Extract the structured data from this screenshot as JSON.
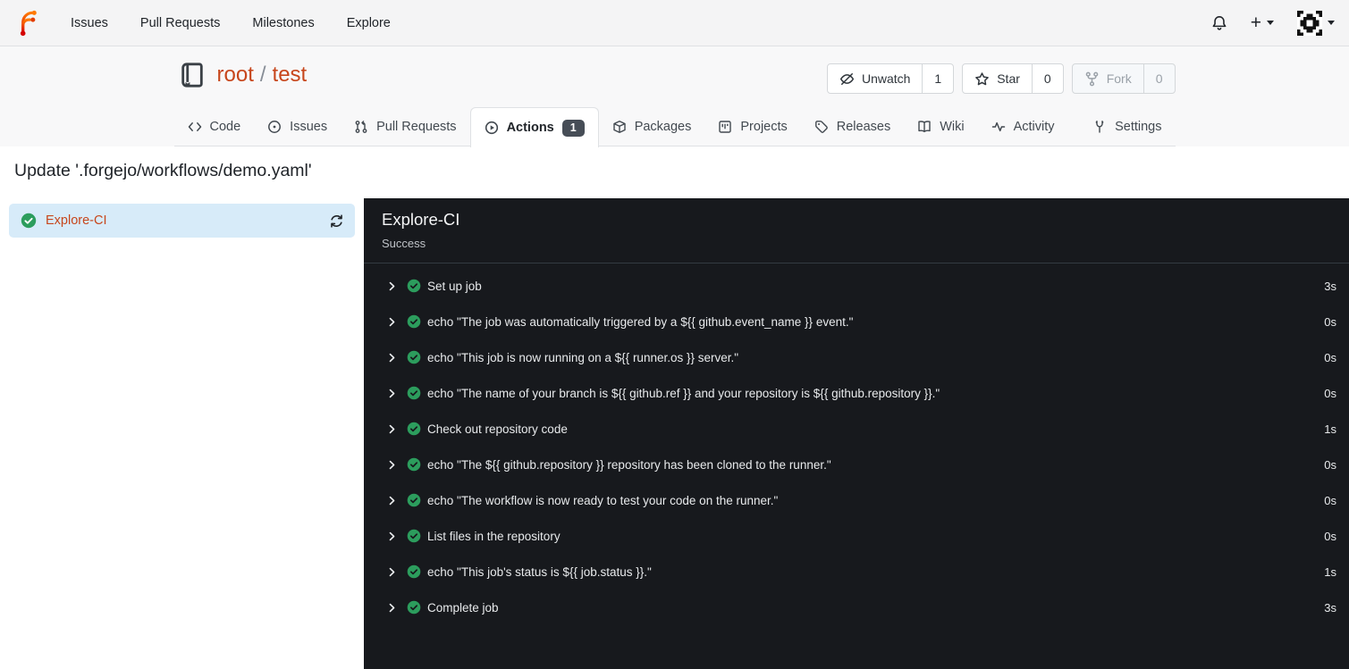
{
  "navbar": {
    "items": [
      {
        "label": "Issues"
      },
      {
        "label": "Pull Requests"
      },
      {
        "label": "Milestones"
      },
      {
        "label": "Explore"
      }
    ]
  },
  "repo": {
    "owner": "root",
    "separator": "/",
    "name": "test",
    "actions": [
      {
        "label": "Unwatch",
        "count": "1"
      },
      {
        "label": "Star",
        "count": "0"
      },
      {
        "label": "Fork",
        "count": "0",
        "disabled": true
      }
    ],
    "tabs": [
      {
        "label": "Code"
      },
      {
        "label": "Issues"
      },
      {
        "label": "Pull Requests"
      },
      {
        "label": "Actions",
        "badge": "1",
        "active": true
      },
      {
        "label": "Packages"
      },
      {
        "label": "Projects"
      },
      {
        "label": "Releases"
      },
      {
        "label": "Wiki"
      },
      {
        "label": "Activity"
      }
    ],
    "settings_tab": {
      "label": "Settings"
    }
  },
  "run": {
    "title": "Update '.forgejo/workflows/demo.yaml'",
    "sidebar_job": {
      "name": "Explore-CI",
      "status": "success"
    },
    "job": {
      "name": "Explore-CI",
      "status": "Success"
    },
    "steps": [
      {
        "label": "Set up job",
        "duration": "3s"
      },
      {
        "label": "echo \"The job was automatically triggered by a ${{ github.event_name }} event.\"",
        "duration": "0s"
      },
      {
        "label": "echo \"This job is now running on a ${{ runner.os }} server.\"",
        "duration": "0s"
      },
      {
        "label": "echo \"The name of your branch is ${{ github.ref }} and your repository is ${{ github.repository }}.\"",
        "duration": "0s"
      },
      {
        "label": "Check out repository code",
        "duration": "1s"
      },
      {
        "label": "echo \"The ${{ github.repository }} repository has been cloned to the runner.\"",
        "duration": "0s"
      },
      {
        "label": "echo \"The workflow is now ready to test your code on the runner.\"",
        "duration": "0s"
      },
      {
        "label": "List files in the repository",
        "duration": "0s"
      },
      {
        "label": "echo \"This job's status is ${{ job.status }}.\"",
        "duration": "1s"
      },
      {
        "label": "Complete job",
        "duration": "3s"
      }
    ]
  },
  "colors": {
    "accent_link": "#c7461c",
    "success_green": "#2c9d5d",
    "console_bg": "#17191d",
    "console_border": "#343b42",
    "selection_blue": "#d7ebf9",
    "badge_bg": "#464d56",
    "header_bg": "#f8f8f9",
    "navbar_bg": "#f4f4f5"
  }
}
